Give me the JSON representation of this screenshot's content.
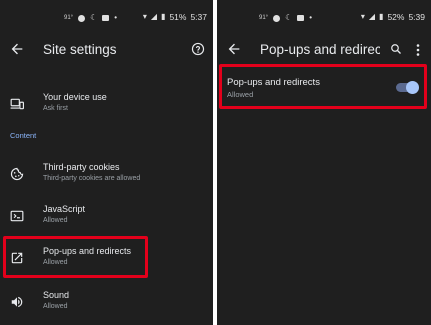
{
  "left": {
    "status": {
      "temp": "91°",
      "battery": "51%",
      "time": "5:37"
    },
    "appbar": {
      "title": "Site settings"
    },
    "device_use": {
      "title": "Your device use",
      "sub": "Ask first"
    },
    "section": "Content",
    "items": [
      {
        "title": "Third-party cookies",
        "sub": "Third-party cookies are allowed",
        "icon": "cookie-icon"
      },
      {
        "title": "JavaScript",
        "sub": "Allowed",
        "icon": "javascript-icon"
      },
      {
        "title": "Pop-ups and redirects",
        "sub": "Allowed",
        "icon": "open-external-icon"
      },
      {
        "title": "Sound",
        "sub": "Allowed",
        "icon": "speaker-icon"
      }
    ]
  },
  "right": {
    "status": {
      "temp": "91°",
      "battery": "52%",
      "time": "5:39"
    },
    "appbar": {
      "title": "Pop-ups and redirects"
    },
    "setting": {
      "title": "Pop-ups and redirects",
      "sub": "Allowed",
      "toggle_on": true
    }
  },
  "colors": {
    "background": "#1f1f1f",
    "accent": "#8ab4f8",
    "highlight": "#e3001b",
    "toggle_thumb": "#a8c7fa"
  }
}
